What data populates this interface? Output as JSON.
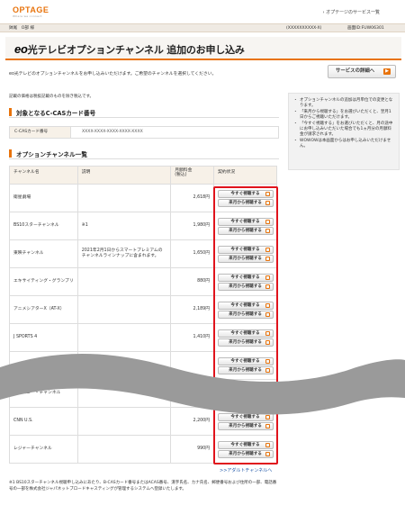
{
  "header": {
    "logo": "OPTAGE",
    "logo_sub": "Where we connect",
    "top_link": "› オプテージのサービス一覧"
  },
  "topbar": {
    "left": "鉢尾　O部 様",
    "middle": "(XXXXXXXXXX-X)",
    "right": "画面ID:FUW06301"
  },
  "title": {
    "eo": "eo",
    "rest": "光テレビオプションチャンネル 追加のお申し込み"
  },
  "intro": "eo光テレビのオプションチャンネルをお申し込みいただけます。ご希望のチャンネルを選択してください。",
  "detail_button": "サービスの詳細へ",
  "note_top": "記載の価格は税抜記載のものを除き税込です。",
  "sections": {
    "cas": "対象となるC-CASカード番号",
    "channels": "オプションチャンネル一覧"
  },
  "cas": {
    "label": "C-CASカード番号",
    "value": "XXXX-XXXX-XXXX-XXXX-XXXX"
  },
  "sidebar": {
    "items": [
      "オプションチャンネルの追加は月単位での変更となります。",
      "「来月から視聴する」をお選びいただくと、翌月1日からご視聴いただけます。",
      "「今すぐ視聴する」をお選びいただくと、月の途中にお申し込みいただいた場合でも1ヵ月分の月額料金が請求されます。",
      "WOWOWは本画面からはお申し込みいただけません。"
    ]
  },
  "table": {
    "headers": {
      "name": "チャンネル名",
      "desc": "説明",
      "price": "月額料金\n(税込)",
      "status": "契約状況"
    },
    "btn_now": "今すぐ視聴する",
    "btn_next": "来月から視聴する",
    "rows": [
      {
        "name": "衛星劇場",
        "desc": "",
        "price": "2,618円"
      },
      {
        "name": "BS10スターチャンネル",
        "desc": "※1",
        "price": "1,980円"
      },
      {
        "name": "東映チャンネル",
        "desc": "2021年2月1日からスマートプレミアムのチャンネルラインナップに含まれます。",
        "price": "1,650円"
      },
      {
        "name": "エキサイティング・グランプリ",
        "desc": "",
        "price": "880円"
      },
      {
        "name": "アニメシアターX（AT-X）",
        "desc": "",
        "price": "2,189円"
      },
      {
        "name": "J SPORTS 4",
        "desc": "",
        "price": "1,410円"
      },
      {
        "name": "",
        "desc": "",
        "price": ""
      },
      {
        "name": "ディズニー・チャンネル",
        "desc": "",
        "price": ""
      },
      {
        "name": "CNN U.S.",
        "desc": "",
        "price": "2,200円"
      },
      {
        "name": "レジャーチャンネル",
        "desc": "",
        "price": "990円"
      }
    ]
  },
  "adult_link": ">>アダルトチャンネルへ",
  "footnote": "※1 BS10スターチャンネル視聴申し込みにあたり、B-CASカード番号またはACAS番号、漢字氏名、カナ氏名、郵便番号および住所の一部、電話番号の一部を株式会社ジャパネットブロードキャスティングが管理するシステムへ登録いたします。",
  "colors": {
    "accent": "#e8730c",
    "highlight": "#e0131c",
    "link": "#2258a8"
  }
}
